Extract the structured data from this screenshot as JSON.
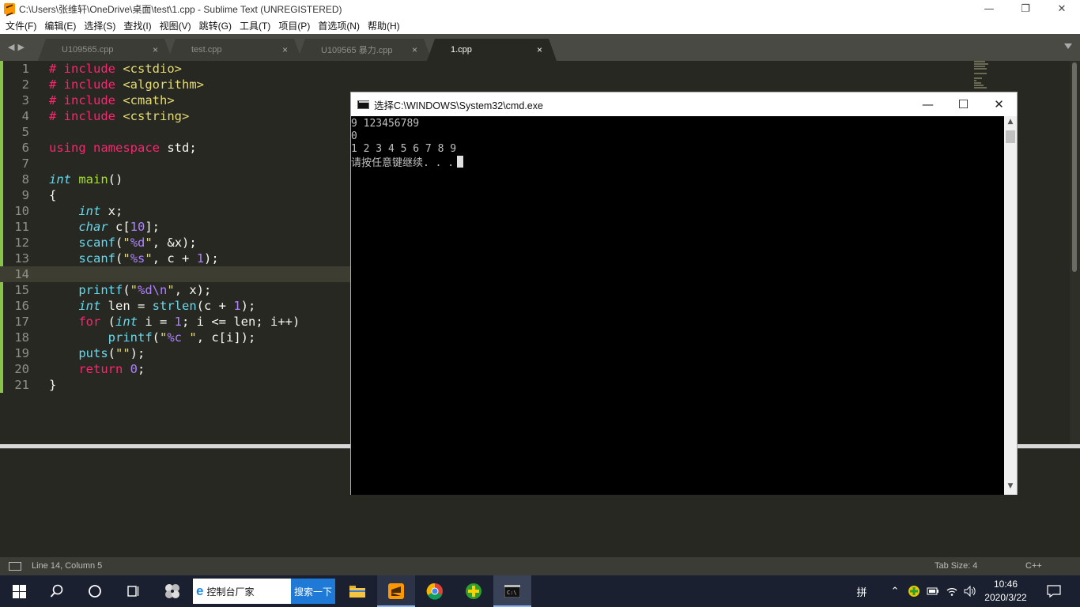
{
  "window": {
    "title": "C:\\Users\\张维轩\\OneDrive\\桌面\\test\\1.cpp - Sublime Text (UNREGISTERED)",
    "min_icon": "minimize-icon",
    "max_icon": "restore-icon",
    "close_icon": "close-icon"
  },
  "menu": [
    "文件(F)",
    "编辑(E)",
    "选择(S)",
    "查找(I)",
    "视图(V)",
    "跳转(G)",
    "工具(T)",
    "项目(P)",
    "首选项(N)",
    "帮助(H)"
  ],
  "tabs": [
    {
      "label": "U109565.cpp",
      "active": false
    },
    {
      "label": "test.cpp",
      "active": false
    },
    {
      "label": "U109565 暴力.cpp",
      "active": false
    },
    {
      "label": "1.cpp",
      "active": true
    }
  ],
  "tab_close_glyph": "×",
  "editor": {
    "current_line": 14,
    "line_numbers": [
      "1",
      "2",
      "3",
      "4",
      "5",
      "6",
      "7",
      "8",
      "9",
      "10",
      "11",
      "12",
      "13",
      "14",
      "15",
      "16",
      "17",
      "18",
      "19",
      "20",
      "21"
    ]
  },
  "console_window": {
    "title": "选择C:\\WINDOWS\\System32\\cmd.exe",
    "lines": [
      "9 123456789",
      "0",
      "1 2 3 4 5 6 7 8 9",
      "请按任意键继续. . ."
    ]
  },
  "status": {
    "position": "Line 14, Column 5",
    "tab_size": "Tab Size: 4",
    "syntax": "C++"
  },
  "taskbar": {
    "search_text": "控制台厂家",
    "search_button": "搜索一下",
    "ime_label": "拼",
    "time": "10:46",
    "date": "2020/3/22"
  },
  "colors": {
    "editor_bg": "#272822",
    "keyword": "#f92672",
    "string": "#e6db74",
    "number": "#ae81ff",
    "function": "#a6e22e",
    "type": "#66d9ef"
  }
}
